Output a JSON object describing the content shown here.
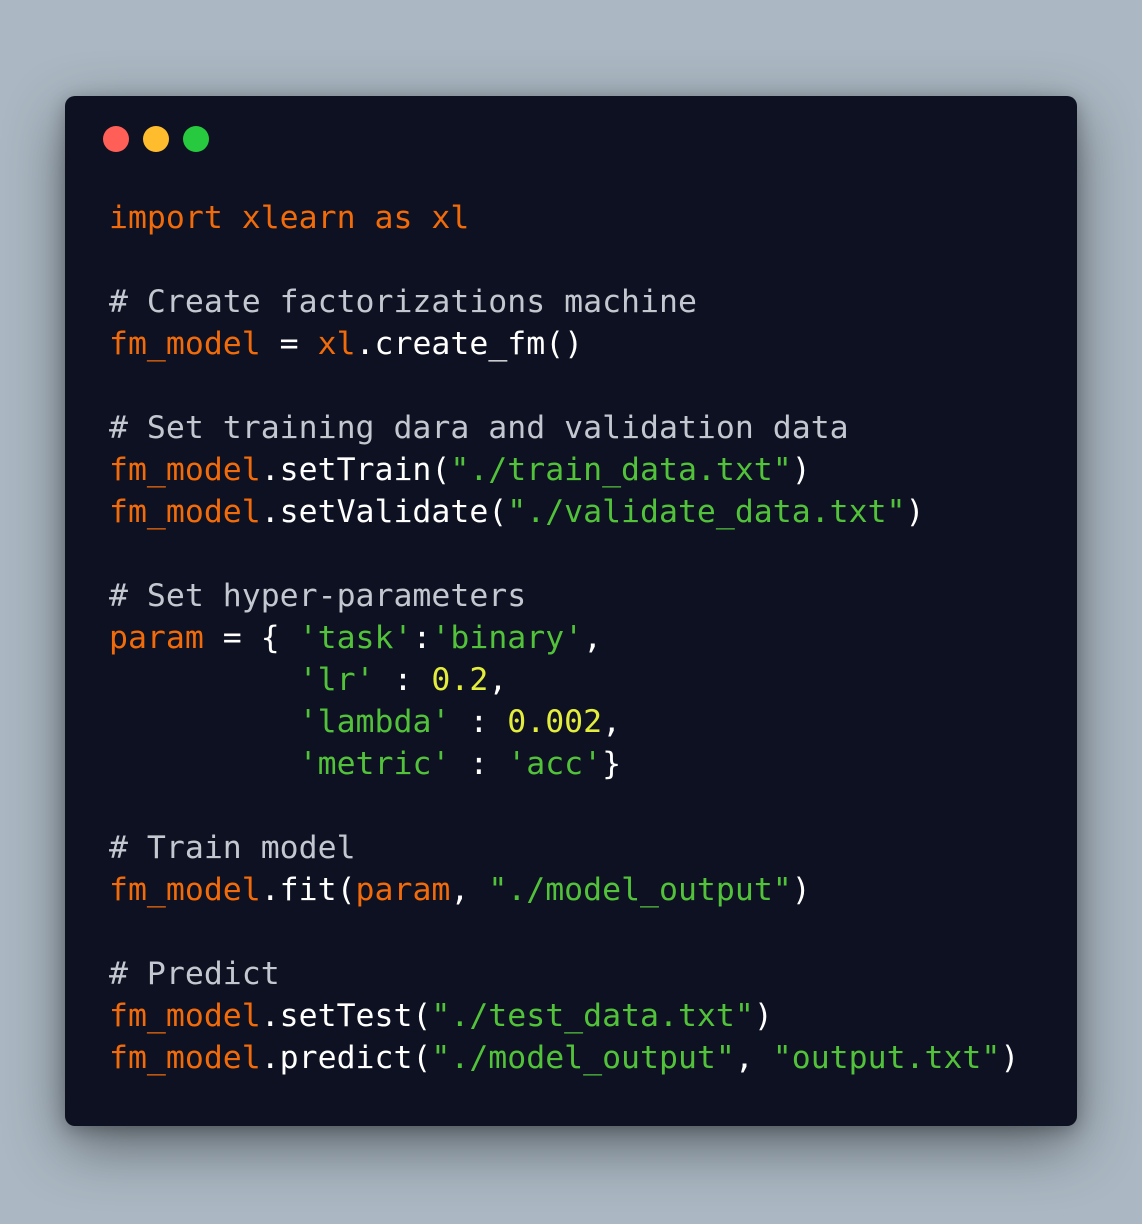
{
  "window": {
    "controls": [
      {
        "name": "close-button",
        "color": "#ff5f56"
      },
      {
        "name": "minimize-button",
        "color": "#ffbd2e"
      },
      {
        "name": "maximize-button",
        "color": "#27c93f"
      }
    ]
  },
  "colors": {
    "background": "#abb8c3",
    "editor_background": "#0d1121",
    "keyword": "#f26b0a",
    "string": "#52c23a",
    "number": "#e3ed3c",
    "comment": "#c3c7cf",
    "plain": "#ffffff"
  },
  "code_lines": [
    [
      {
        "t": "kw",
        "v": "import xlearn as xl"
      }
    ],
    [],
    [
      {
        "t": "com",
        "v": "# Create factorizations machine"
      }
    ],
    [
      {
        "t": "id",
        "v": "fm_model"
      },
      {
        "t": "plain",
        "v": " = "
      },
      {
        "t": "id",
        "v": "xl"
      },
      {
        "t": "plain",
        "v": ".create_fm()"
      }
    ],
    [],
    [
      {
        "t": "com",
        "v": "# Set training dara and validation data"
      }
    ],
    [
      {
        "t": "id",
        "v": "fm_model"
      },
      {
        "t": "plain",
        "v": ".setTrain("
      },
      {
        "t": "str",
        "v": "\"./train_data.txt\""
      },
      {
        "t": "plain",
        "v": ")"
      }
    ],
    [
      {
        "t": "id",
        "v": "fm_model"
      },
      {
        "t": "plain",
        "v": ".setValidate("
      },
      {
        "t": "str",
        "v": "\"./validate_data.txt\""
      },
      {
        "t": "plain",
        "v": ")"
      }
    ],
    [],
    [
      {
        "t": "com",
        "v": "# Set hyper-parameters"
      }
    ],
    [
      {
        "t": "id",
        "v": "param"
      },
      {
        "t": "plain",
        "v": " = { "
      },
      {
        "t": "str",
        "v": "'task'"
      },
      {
        "t": "plain",
        "v": ":"
      },
      {
        "t": "str",
        "v": "'binary'"
      },
      {
        "t": "plain",
        "v": ","
      }
    ],
    [
      {
        "t": "plain",
        "v": "          "
      },
      {
        "t": "str",
        "v": "'lr'"
      },
      {
        "t": "plain",
        "v": " : "
      },
      {
        "t": "num",
        "v": "0.2"
      },
      {
        "t": "plain",
        "v": ","
      }
    ],
    [
      {
        "t": "plain",
        "v": "          "
      },
      {
        "t": "str",
        "v": "'lambda'"
      },
      {
        "t": "plain",
        "v": " : "
      },
      {
        "t": "num",
        "v": "0.002"
      },
      {
        "t": "plain",
        "v": ","
      }
    ],
    [
      {
        "t": "plain",
        "v": "          "
      },
      {
        "t": "str",
        "v": "'metric'"
      },
      {
        "t": "plain",
        "v": " : "
      },
      {
        "t": "str",
        "v": "'acc'"
      },
      {
        "t": "plain",
        "v": "}"
      }
    ],
    [],
    [
      {
        "t": "com",
        "v": "# Train model"
      }
    ],
    [
      {
        "t": "id",
        "v": "fm_model"
      },
      {
        "t": "plain",
        "v": ".fit("
      },
      {
        "t": "id",
        "v": "param"
      },
      {
        "t": "plain",
        "v": ", "
      },
      {
        "t": "str",
        "v": "\"./model_output\""
      },
      {
        "t": "plain",
        "v": ")"
      }
    ],
    [],
    [
      {
        "t": "com",
        "v": "# Predict"
      }
    ],
    [
      {
        "t": "id",
        "v": "fm_model"
      },
      {
        "t": "plain",
        "v": ".setTest("
      },
      {
        "t": "str",
        "v": "\"./test_data.txt\""
      },
      {
        "t": "plain",
        "v": ")"
      }
    ],
    [
      {
        "t": "id",
        "v": "fm_model"
      },
      {
        "t": "plain",
        "v": ".predict("
      },
      {
        "t": "str",
        "v": "\"./model_output\""
      },
      {
        "t": "plain",
        "v": ", "
      },
      {
        "t": "str",
        "v": "\"output.txt\""
      },
      {
        "t": "plain",
        "v": ")"
      }
    ]
  ]
}
